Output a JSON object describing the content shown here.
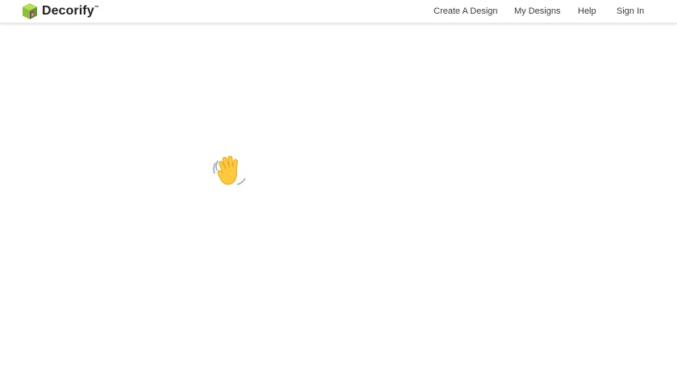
{
  "header": {
    "logo": {
      "text": "Decorify",
      "trademark": "™",
      "icon": "cube-logo-icon"
    },
    "nav": {
      "create_design": "Create A Design",
      "my_designs": "My Designs",
      "help": "Help",
      "sign_in": "Sign In"
    }
  },
  "main": {
    "greeting_icon": "waving-hand-icon"
  },
  "colors": {
    "logo_green": "#9ccb3b",
    "logo_dark_green": "#5a8f2a",
    "logo_purple": "#7b3f8f",
    "logo_orange": "#f0a030",
    "nav_text": "#3c3c3c",
    "wave_yellow": "#ffc83d"
  }
}
